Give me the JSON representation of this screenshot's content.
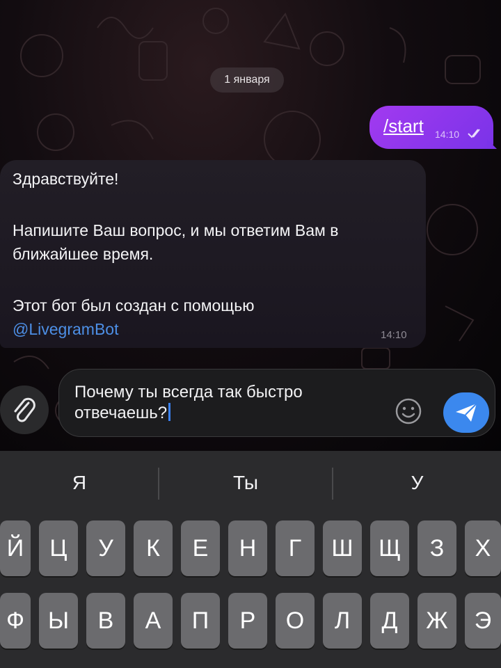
{
  "chat": {
    "date_label": "1 января",
    "outgoing": {
      "text": "/start",
      "time": "14:10"
    },
    "incoming": {
      "lines": [
        "Здравствуйте!",
        "Напишите Ваш вопрос, и мы ответим Вам в",
        "ближайшее время.",
        "Этот бот был создан с помощью"
      ],
      "link": "@LivegramBot",
      "time": "14:10"
    }
  },
  "composer": {
    "text": "Почему ты всегда так быстро\nотвечаешь?"
  },
  "keyboard": {
    "suggestions": [
      "Я",
      "Ты",
      "У"
    ],
    "row1": [
      "Й",
      "Ц",
      "У",
      "К",
      "Е",
      "Н",
      "Г",
      "Ш",
      "Щ",
      "З",
      "Х"
    ],
    "row2": [
      "Ф",
      "Ы",
      "В",
      "А",
      "П",
      "Р",
      "О",
      "Л",
      "Д",
      "Ж",
      "Э"
    ]
  },
  "colors": {
    "outgoing_bubble": "#8e37ee",
    "incoming_bubble": "#1e1a22",
    "link": "#4d8fe6",
    "send_button": "#3b88ee"
  }
}
